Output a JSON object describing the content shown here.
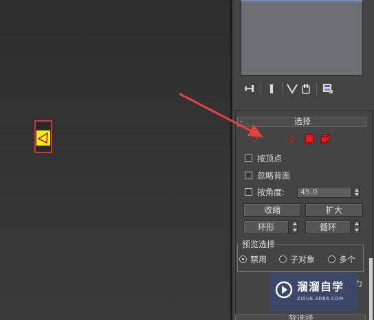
{
  "rollout": {
    "toggle": "-",
    "title": "选择"
  },
  "toolbar": {
    "icons": [
      "pin-stack-icon",
      "show-end-result-icon",
      "make-unique-icon",
      "remove-modifier-icon",
      "configure-modifier-sets-icon"
    ]
  },
  "selection_levels": [
    "vertex-icon",
    "edge-icon",
    "face-icon",
    "polygon-icon",
    "element-icon"
  ],
  "options": {
    "by_vertex": "按顶点",
    "ignore_backfacing": "忽略背面",
    "by_angle": "按角度:",
    "angle_value": "45.0"
  },
  "buttons": {
    "shrink": "收缩",
    "grow": "扩大",
    "ring": "环形",
    "loop": "循环"
  },
  "preview": {
    "legend": "预览选择",
    "disabled": "禁用",
    "subobject": "子对象",
    "multi": "多个",
    "selected": "disabled"
  },
  "watermark": {
    "title": "溜溜自学",
    "subtitle": "ZIXUE.3D66.COM",
    "side_text": "力"
  },
  "bottom_rollout": {
    "title": "软选择"
  },
  "colors": {
    "highlight": "#e03030",
    "active_level": "#f4f000",
    "arrow": "#e84040"
  }
}
